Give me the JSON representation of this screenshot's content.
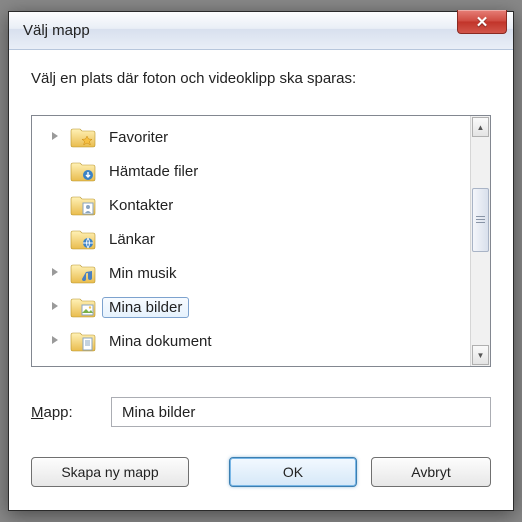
{
  "title": "Välj mapp",
  "instruction": "Välj en plats där foton och videoklipp ska sparas:",
  "tree": [
    {
      "label": "Favoriter",
      "icon": "folder-star",
      "expandable": true,
      "selected": false
    },
    {
      "label": "Hämtade filer",
      "icon": "folder-download",
      "expandable": false,
      "selected": false
    },
    {
      "label": "Kontakter",
      "icon": "folder-contacts",
      "expandable": false,
      "selected": false
    },
    {
      "label": "Länkar",
      "icon": "folder-links",
      "expandable": false,
      "selected": false
    },
    {
      "label": "Min musik",
      "icon": "folder-music",
      "expandable": true,
      "selected": false
    },
    {
      "label": "Mina bilder",
      "icon": "folder-pictures",
      "expandable": true,
      "selected": true
    },
    {
      "label": "Mina dokument",
      "icon": "folder-docs",
      "expandable": true,
      "selected": false
    }
  ],
  "field": {
    "label_prefix": "M",
    "label_rest": "app:",
    "value": "Mina bilder"
  },
  "buttons": {
    "new_folder": "Skapa ny mapp",
    "ok": "OK",
    "cancel": "Avbryt"
  },
  "colors": {
    "accent": "#3c7fb1",
    "close": "#c1342a"
  }
}
